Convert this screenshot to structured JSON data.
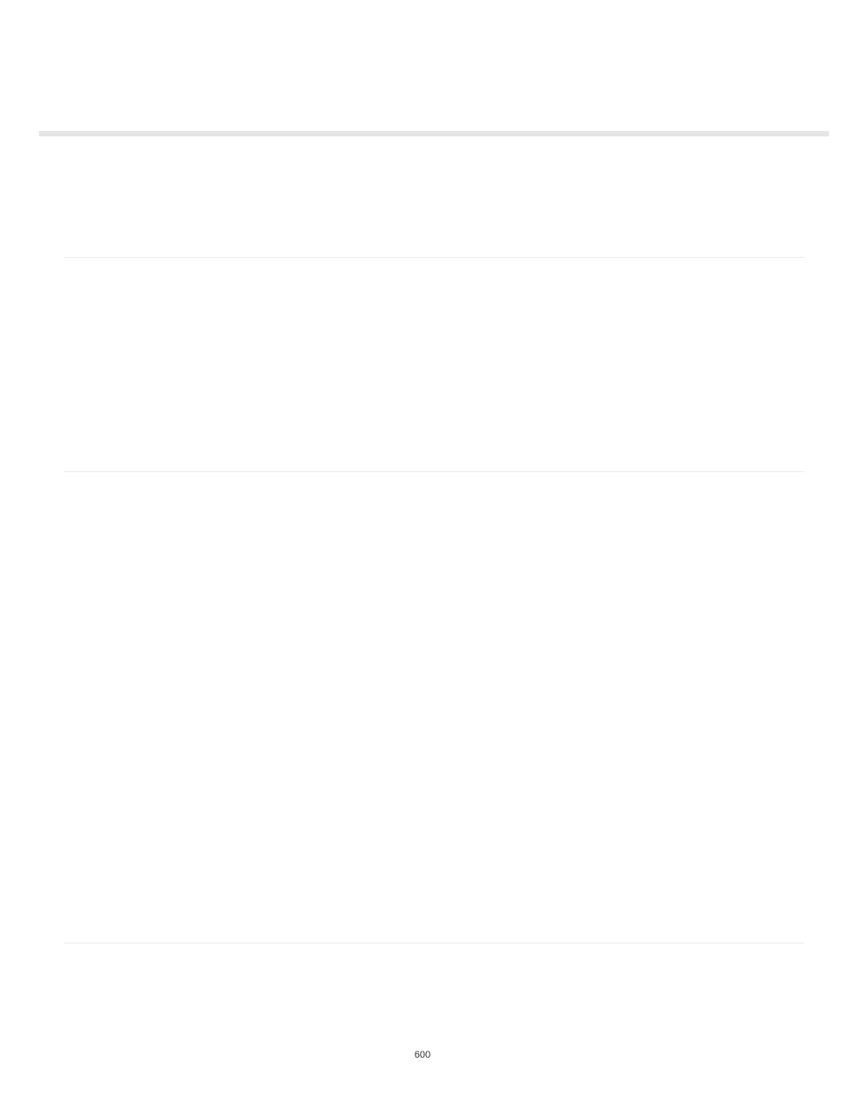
{
  "page_number": "600"
}
